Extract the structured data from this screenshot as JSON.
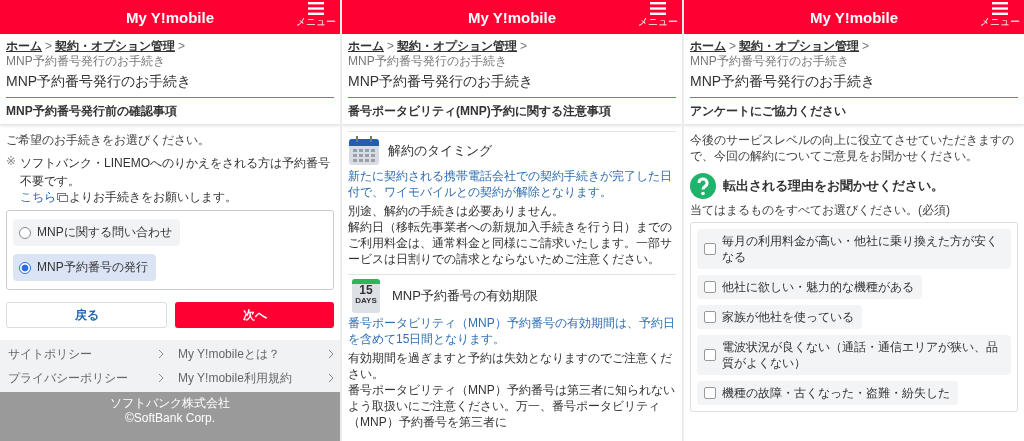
{
  "panels": [
    {
      "kind": "selection",
      "header": {
        "logo": "My Y!mobile",
        "menu_label": "メニュー"
      },
      "breadcrumb": [
        {
          "kind": "link",
          "text": "ホーム"
        },
        {
          "kind": "separator",
          "text": ">"
        },
        {
          "kind": "link",
          "text": "契約・オプション管理"
        },
        {
          "kind": "separator",
          "text": ">"
        },
        {
          "kind": "current",
          "text": "MNP予約番号発行のお手続き"
        }
      ],
      "title": "MNP予約番号発行のお手続き",
      "section_title": "MNP予約番号発行前の確認事項",
      "intro": "ご希望のお手続きをお選びください。",
      "note": {
        "mark": "※",
        "text": "ソフトバンク・LINEMOへのりかえをされる方は予約番号不要です。",
        "link": "こちら",
        "after": "よりお手続きをお願いします。"
      },
      "options": [
        {
          "label": "MNPに関する問い合わせ",
          "selected": false
        },
        {
          "label": "MNP予約番号の発行",
          "selected": true
        }
      ],
      "buttons": {
        "back": "戻る",
        "next": "次へ"
      },
      "footer_links": [
        "サイトポリシー",
        "My Y!mobileとは？",
        "プライバシーポリシー",
        "My Y!mobile利用規約"
      ],
      "copyright": [
        "ソフトバンク株式会社",
        "©SoftBank Corp."
      ]
    },
    {
      "kind": "notice",
      "header": {
        "logo": "My Y!mobile",
        "menu_label": "メニュー"
      },
      "breadcrumb": [
        {
          "kind": "link",
          "text": "ホーム"
        },
        {
          "kind": "separator",
          "text": ">"
        },
        {
          "kind": "link",
          "text": "契約・オプション管理"
        },
        {
          "kind": "separator",
          "text": ">"
        },
        {
          "kind": "current",
          "text": "MNP予約番号発行のお手続き"
        }
      ],
      "title": "MNP予約番号発行のお手続き",
      "section_title": "番号ポータビリティ(MNP)予約に関する注意事項",
      "sections": [
        {
          "heading": "解約のタイミング",
          "lead": "新たに契約される携帯電話会社での契約手続きが完了した日付で、ワイモバイルとの契約が解除となります。",
          "body": [
            "別途、解約の手続きは必要ありません。",
            "解約日（移転先事業者への新規加入手続きを行う日）までのご利用料金は、通常料金と同様にご請求いたします。一部サービスは日割りでの請求とならないためご注意ください。"
          ]
        },
        {
          "icon_number": "15",
          "icon_caption": "DAYS",
          "heading": "MNP予約番号の有効期限",
          "lead": "番号ポータビリティ（MNP）予約番号の有効期間は、予約日を含めて15日間となります。",
          "body": [
            "有効期間を過ぎますと予約は失効となりますのでご注意ください。",
            "番号ポータビリティ（MNP）予約番号は第三者に知られないよう取扱いにご注意ください。万一、番号ポータビリティ（MNP）予約番号を第三者に"
          ]
        }
      ]
    },
    {
      "kind": "survey",
      "header": {
        "logo": "My Y!mobile",
        "menu_label": "メニュー"
      },
      "breadcrumb": [
        {
          "kind": "link",
          "text": "ホーム"
        },
        {
          "kind": "separator",
          "text": ">"
        },
        {
          "kind": "link",
          "text": "契約・オプション管理"
        },
        {
          "kind": "separator",
          "text": ">"
        },
        {
          "kind": "current",
          "text": "MNP予約番号発行のお手続き"
        }
      ],
      "title": "MNP予約番号発行のお手続き",
      "section_title": "アンケートにご協力ください",
      "intro": "今後のサービスレベルの向上に役立てさせていただきますので、今回の解約についてご意見をお聞かせください。",
      "question": "転出される理由をお聞かせください。",
      "hint": "当てはまるものをすべてお選びください。(必須)",
      "choices": [
        {
          "label": "毎月の利用料金が高い・他社に乗り換えた方が安くなる",
          "checked": false
        },
        {
          "label": "他社に欲しい・魅力的な機種がある",
          "checked": false
        },
        {
          "label": "家族が他社を使っている",
          "checked": false
        },
        {
          "label": "電波状況が良くない（通話・通信エリアが狭い、品質がよくない）",
          "checked": false
        },
        {
          "label": "機種の故障・古くなった・盗難・紛失した",
          "checked": false
        }
      ]
    }
  ]
}
